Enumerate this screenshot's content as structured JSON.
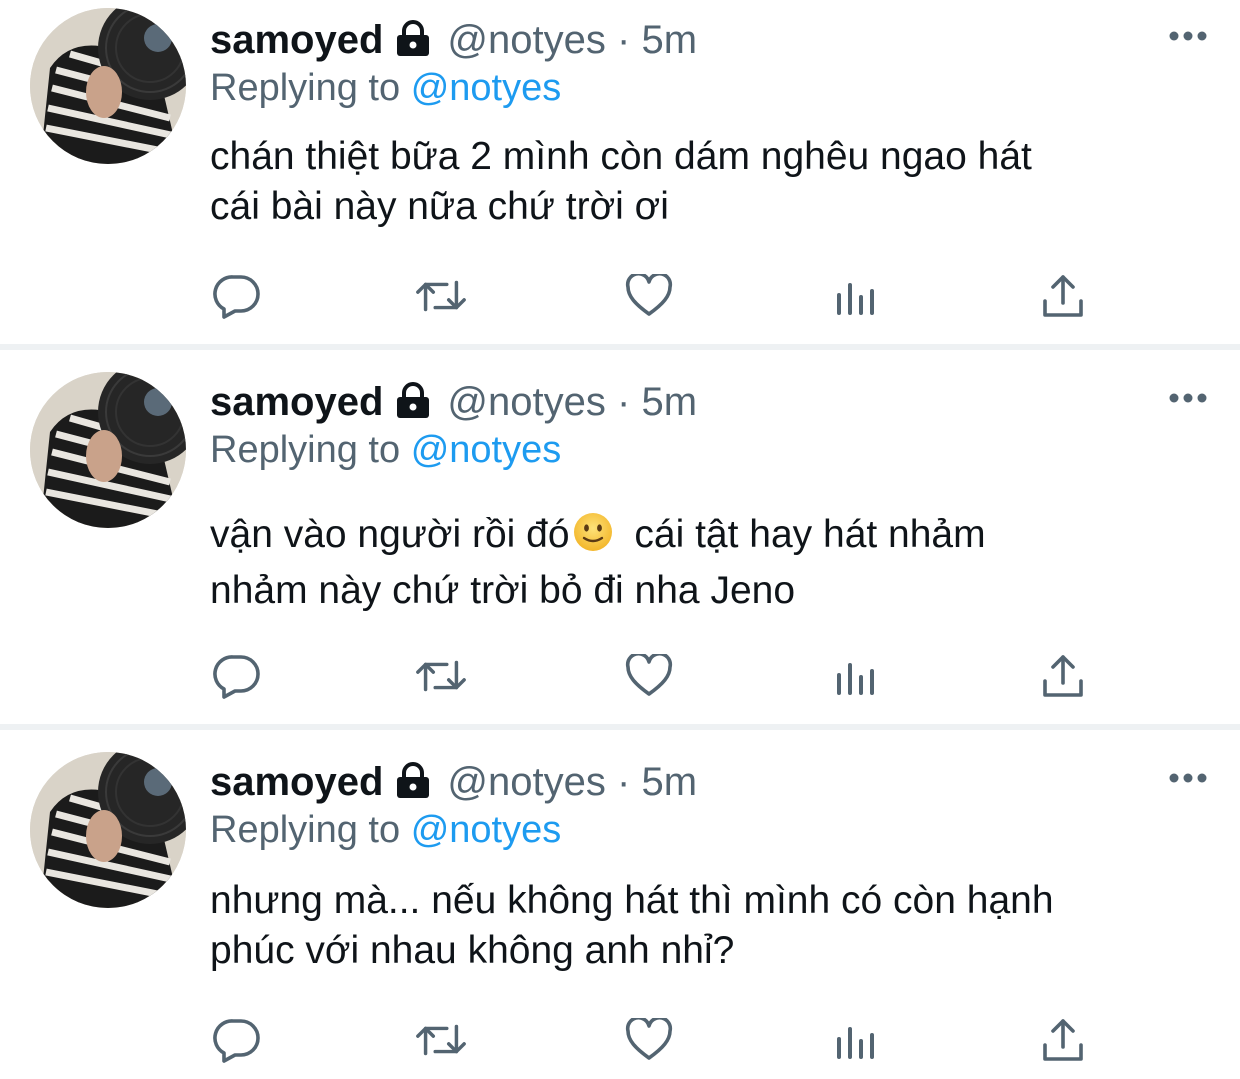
{
  "colors": {
    "text_primary": "#0f1419",
    "text_secondary": "#536471",
    "mention": "#1d9bf0",
    "divider": "#eef1f3"
  },
  "tweets": [
    {
      "name": "samoyed",
      "handle": "@notyes",
      "separator": "·",
      "time": "5m",
      "replying_prefix": "Replying to",
      "replying_to": "@notyes",
      "text": "chán thiệt bữa 2 mình còn dám nghêu ngao hát\ncái bài này nữa chứ trời ơi",
      "icons": [
        "avatar",
        "lock-icon",
        "more-icon",
        "reply-icon",
        "retweet-icon",
        "like-icon",
        "analytics-icon",
        "share-icon"
      ]
    },
    {
      "name": "samoyed",
      "handle": "@notyes",
      "separator": "·",
      "time": "5m",
      "replying_prefix": "Replying to",
      "replying_to": "@notyes",
      "text_before_emoji": "vận vào người rồi đó",
      "emoji": "slightly-smiling-face-emoji",
      "text_after_emoji": " cái tật hay hát nhảm\nnhảm này chứ trời bỏ đi nha Jeno",
      "icons": [
        "avatar",
        "lock-icon",
        "more-icon",
        "reply-icon",
        "retweet-icon",
        "like-icon",
        "analytics-icon",
        "share-icon"
      ]
    },
    {
      "name": "samoyed",
      "handle": "@notyes",
      "separator": "·",
      "time": "5m",
      "replying_prefix": "Replying to",
      "replying_to": "@notyes",
      "text": "nhưng mà... nếu không hát thì mình có còn hạnh\nphúc với nhau không anh nhỉ?",
      "icons": [
        "avatar",
        "lock-icon",
        "more-icon",
        "reply-icon",
        "retweet-icon",
        "like-icon",
        "analytics-icon",
        "share-icon"
      ]
    }
  ]
}
